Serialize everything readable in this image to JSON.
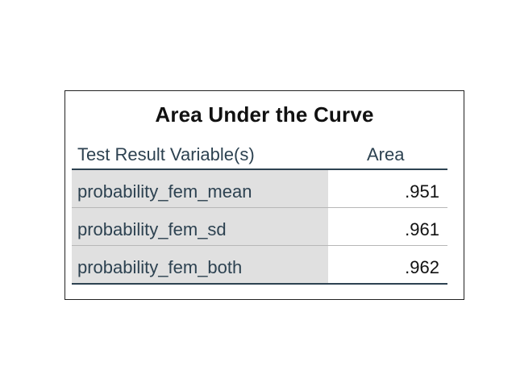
{
  "table": {
    "title": "Area Under the Curve",
    "headers": {
      "col1": "Test Result Variable(s)",
      "col2": "Area"
    },
    "rows": [
      {
        "variable": "probability_fem_mean",
        "area": ".951"
      },
      {
        "variable": "probability_fem_sd",
        "area": ".961"
      },
      {
        "variable": "probability_fem_both",
        "area": ".962"
      }
    ]
  },
  "colors": {
    "header_text": "#2d4251",
    "label_bg": "#e0e0e0",
    "rule": "#2d4251"
  }
}
